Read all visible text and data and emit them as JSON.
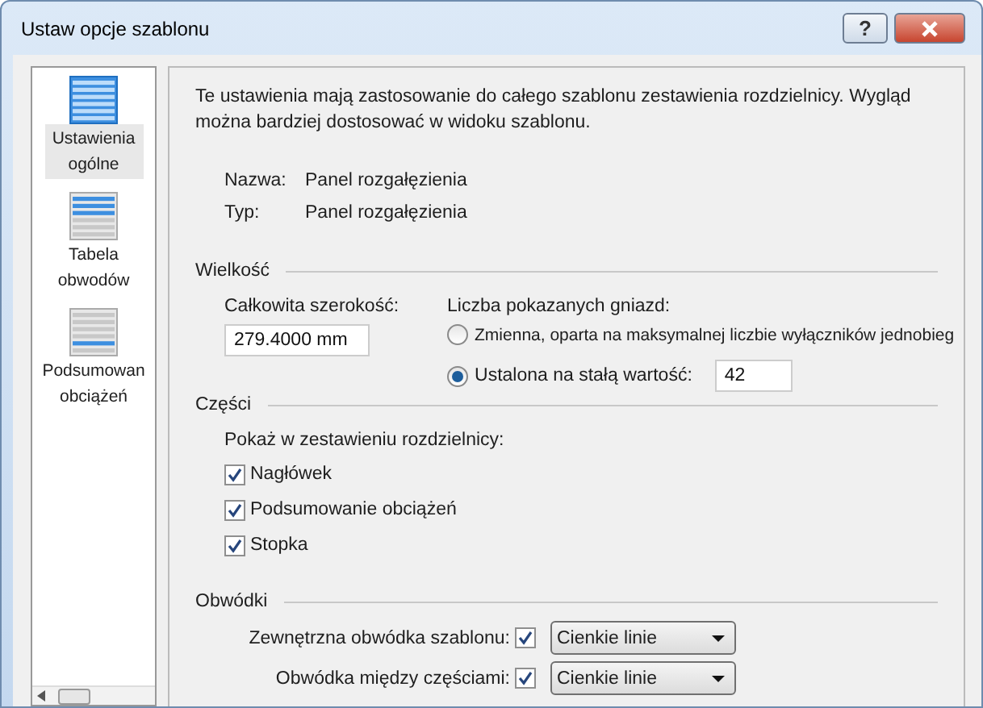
{
  "window": {
    "title": "Ustaw opcje szablonu",
    "buttons": [
      {
        "kind": "help",
        "label": "?"
      },
      {
        "kind": "close"
      }
    ]
  },
  "sidebar": {
    "items": [
      {
        "label": "Ustawienia ogólne",
        "selected": true,
        "kind": "general"
      },
      {
        "label": "Tabela obwodów",
        "selected": false,
        "kind": "table"
      },
      {
        "label": "Podsumowan obciążeń",
        "selected": false,
        "kind": "summary"
      }
    ]
  },
  "intro": "Te ustawienia mają zastosowanie do całego szablonu zestawienia rozdzielnicy. Wygląd można bardziej dostosować w widoku szablonu.",
  "info": [
    {
      "label": "Nazwa:",
      "value": "Panel rozgałęzienia"
    },
    {
      "label": "Typ:",
      "value": "Panel rozgałęzienia"
    }
  ],
  "size": {
    "heading": "Wielkość",
    "width_label": "Całkowita szerokość:",
    "width_value": "279.4000 mm",
    "slots_label": "Liczba pokazanych gniazd:",
    "options": [
      {
        "label": "Zmienna, oparta na maksymalnej liczbie wyłączników jednobieg",
        "selected": false
      },
      {
        "label": "Ustalona na stałą wartość:",
        "selected": true,
        "value": "42"
      }
    ]
  },
  "parts": {
    "heading": "Części",
    "subheading": "Pokaż w zestawieniu rozdzielnicy:",
    "items": [
      {
        "label": "Nagłówek",
        "checked": true
      },
      {
        "label": "Podsumowanie obciążeń",
        "checked": true
      },
      {
        "label": "Stopka",
        "checked": true
      }
    ]
  },
  "borders": {
    "heading": "Obwódki",
    "rows": [
      {
        "label": "Zewnętrzna obwódka szablonu:",
        "checked": true,
        "value": "Cienkie linie"
      },
      {
        "label": "Obwódka między częściami:",
        "checked": true,
        "value": "Cienkie linie"
      }
    ]
  }
}
